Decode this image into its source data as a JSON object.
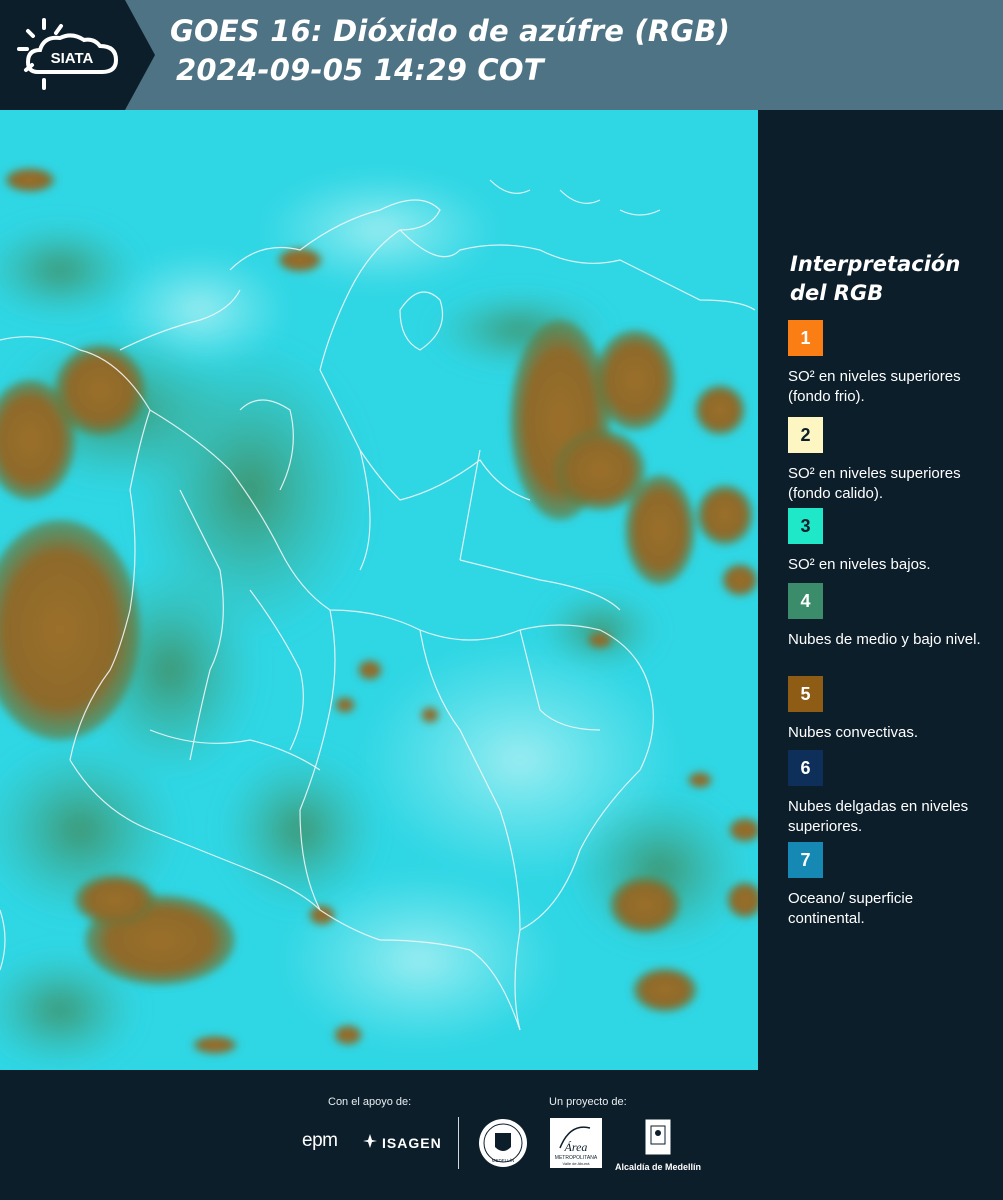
{
  "header": {
    "brand": "SIATA",
    "title_line1": "GOES 16: Dióxido de azúfre (RGB)",
    "title_line2": "2024-09-05 14:29 COT"
  },
  "legend": {
    "title": "Interpretación del RGB",
    "items": [
      {
        "number": "1",
        "color": "#fb7e14",
        "text_color": "#ffffff",
        "label": "SO² en niveles superiores (fondo frio)."
      },
      {
        "number": "2",
        "color": "#fdf6c3",
        "text_color": "#0d1e2b",
        "label": "SO² en niveles superiores (fondo calido)."
      },
      {
        "number": "3",
        "color": "#1fe8c8",
        "text_color": "#0d1e2b",
        "label": "SO² en niveles bajos."
      },
      {
        "number": "4",
        "color": "#3a8c6a",
        "text_color": "#ffffff",
        "label": "Nubes de medio y bajo nivel."
      },
      {
        "number": "5",
        "color": "#8e5c14",
        "text_color": "#ffffff",
        "label": "Nubes convectivas."
      },
      {
        "number": "6",
        "color": "#0d2f5a",
        "text_color": "#ffffff",
        "label": "Nubes delgadas en niveles superiores."
      },
      {
        "number": "7",
        "color": "#1688b4",
        "text_color": "#ffffff",
        "label": "Oceano/ superficie continental."
      }
    ]
  },
  "footer": {
    "support_caption": "Con el apoyo de:",
    "project_caption": "Un proyecto de:",
    "sponsor_1": "epm",
    "sponsor_2": "ISAGEN",
    "partner_1_line1": "Área",
    "partner_1_line2": "METROPOLITANA",
    "partner_1_line3": "Valle de Aburrá",
    "partner_2": "Alcaldía de Medellín",
    "seal_text": "MEDELLÍN"
  },
  "colors": {
    "header_bg": "#4e7384",
    "dark_bg": "#0d1e2b",
    "map_cyan": "#2fd9e6",
    "cloud_brown": "#9a7028",
    "cloud_green": "#3f9a7a"
  }
}
